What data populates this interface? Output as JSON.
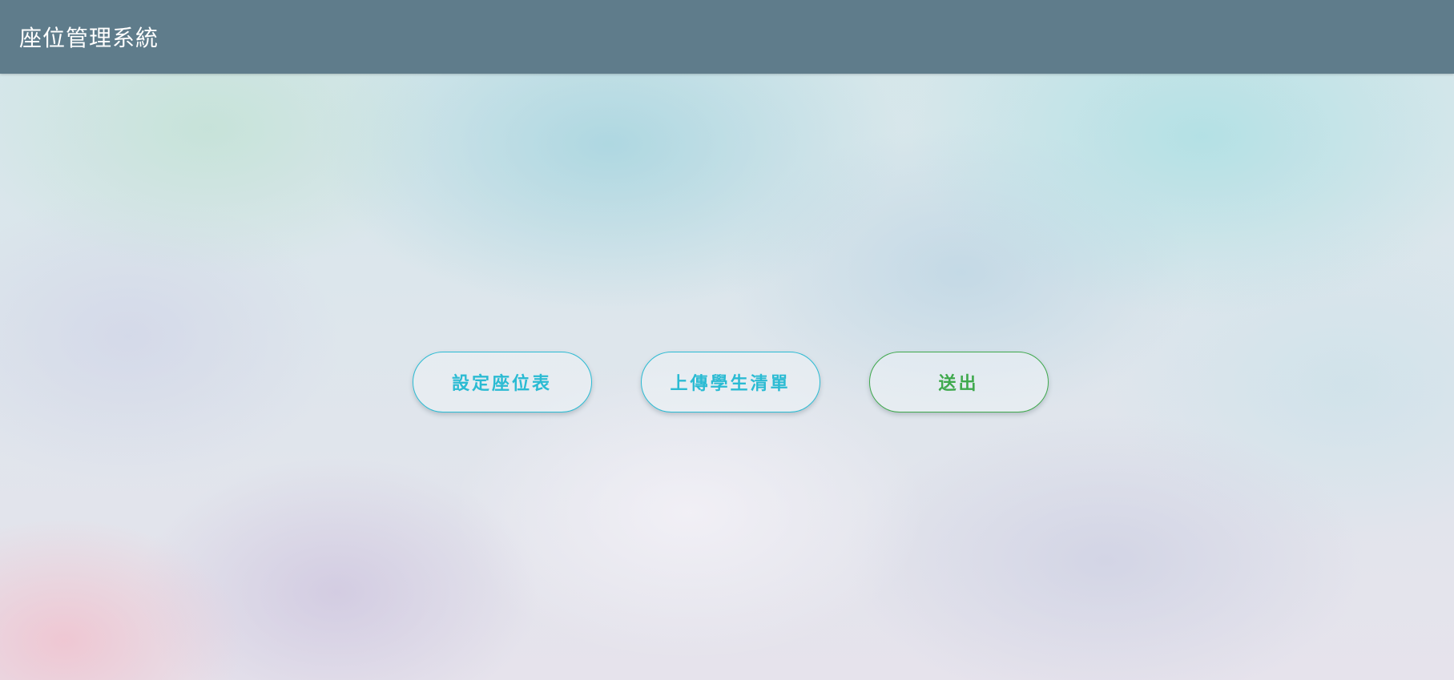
{
  "navbar": {
    "brand": "座位管理系統",
    "background_color": "#5f7c8b"
  },
  "actions": {
    "set_seating_label": "設定座位表",
    "upload_students_label": "上傳學生清單",
    "submit_label": "送出",
    "info_color": "#2bbbd3",
    "success_color": "#3fa94d"
  }
}
